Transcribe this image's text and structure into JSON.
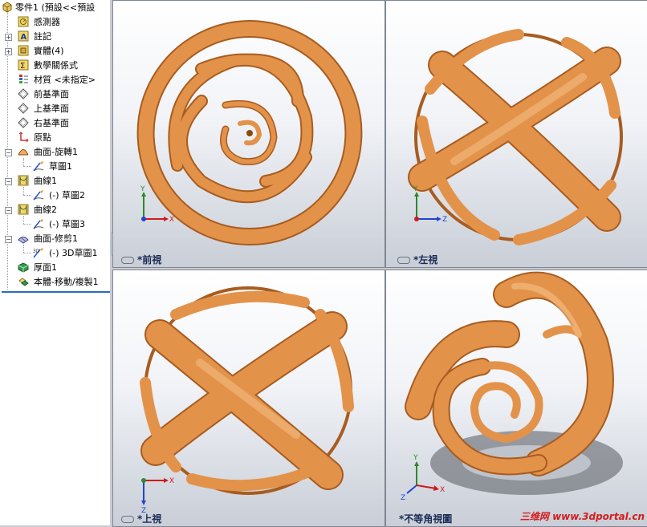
{
  "feature_tree": {
    "root_label": "零件1 (預設<<預設",
    "items": [
      {
        "label": "感測器",
        "icon": "sensor-icon"
      },
      {
        "label": "註記",
        "icon": "annotation-icon"
      },
      {
        "label": "實體(4)",
        "icon": "solid-bodies-icon"
      },
      {
        "label": "數學關係式",
        "icon": "equations-icon"
      },
      {
        "label": "材質 <未指定>",
        "icon": "material-icon"
      },
      {
        "label": "前基準面",
        "icon": "plane-icon"
      },
      {
        "label": "上基準面",
        "icon": "plane-icon"
      },
      {
        "label": "右基準面",
        "icon": "plane-icon"
      },
      {
        "label": "原點",
        "icon": "origin-icon"
      },
      {
        "label": "曲面-旋轉1",
        "icon": "revolve-surface-icon"
      },
      {
        "label": "草圖1",
        "icon": "sketch-icon"
      },
      {
        "label": "曲線1",
        "icon": "curve-icon"
      },
      {
        "label": "(-) 草圖2",
        "icon": "sketch-icon"
      },
      {
        "label": "曲線2",
        "icon": "curve-icon"
      },
      {
        "label": "(-) 草圖3",
        "icon": "sketch-icon"
      },
      {
        "label": "曲面-修剪1",
        "icon": "trim-surface-icon"
      },
      {
        "label": "(-) 3D草圖1",
        "icon": "3d-sketch-icon"
      },
      {
        "label": "厚面1",
        "icon": "thicken-icon"
      },
      {
        "label": "本體-移動/複製1",
        "icon": "move-copy-icon"
      }
    ]
  },
  "viewports": {
    "front": {
      "label": "*前視"
    },
    "left": {
      "label": "*左視"
    },
    "top": {
      "label": "*上視"
    },
    "iso": {
      "label": "*不等角視圖"
    }
  },
  "triad": {
    "x": "X",
    "y": "Y",
    "z": "Z"
  },
  "watermark": "三维网 www.3dportal.cn",
  "colors": {
    "ribbon": "#e3924a",
    "ribbon_dark": "#a85c1f",
    "ribbon_light": "#f6c48c",
    "axis_x": "#d11a1a",
    "axis_y": "#2a8a2a",
    "axis_z": "#2244cc"
  }
}
